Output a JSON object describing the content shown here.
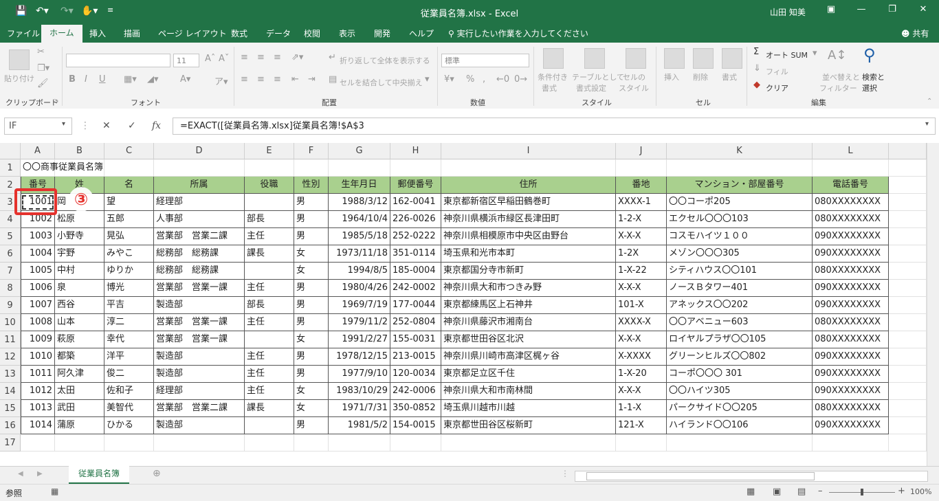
{
  "titlebar": {
    "doc_title": "従業員名簿.xlsx  -  Excel",
    "user": "山田 知美",
    "bg": "#217346"
  },
  "tabs": [
    "ファイル",
    "ホーム",
    "挿入",
    "描画",
    "ページ レイアウト",
    "数式",
    "データ",
    "校閲",
    "表示",
    "開発",
    "ヘルプ"
  ],
  "tell_me": "実行したい作業を入力してください",
  "share": "共有",
  "ribbon": {
    "groups": [
      "クリップボード",
      "フォント",
      "配置",
      "数値",
      "スタイル",
      "セル",
      "編集"
    ],
    "paste": "貼り付け",
    "font_size": "11",
    "wrap_text": "折り返して全体を表示する",
    "merge_center": "セルを結合して中央揃え",
    "number_format": "標準",
    "cond_format": [
      "条件付き",
      "書式"
    ],
    "table_format": [
      "テーブルとして",
      "書式設定"
    ],
    "cell_styles": [
      "セルの",
      "スタイル"
    ],
    "insert": "挿入",
    "delete": "削除",
    "format": "書式",
    "autosum": "オート SUM",
    "fill": "フィル",
    "clear": "クリア",
    "sort_filter": [
      "並べ替えと",
      "フィルター"
    ],
    "find_select": [
      "検索と",
      "選択"
    ]
  },
  "formula_bar": {
    "name_box": "IF",
    "formula": "=EXACT([従業員名簿.xlsx]従業員名簿!$A$3"
  },
  "columns": [
    "A",
    "B",
    "C",
    "D",
    "E",
    "F",
    "G",
    "H",
    "I",
    "J",
    "K",
    "L"
  ],
  "title_cell": "〇〇商事従業員名簿",
  "headers": [
    "番号",
    "姓",
    "名",
    "所属",
    "役職",
    "性別",
    "生年月日",
    "郵便番号",
    "住所",
    "番地",
    "マンション・部屋番号",
    "電話番号"
  ],
  "rows": [
    [
      "1001",
      "岡",
      "望",
      "経理部",
      "",
      "男",
      "1988/3/12",
      "162-0041",
      "東京都新宿区早稲田鶴巻町",
      "XXXX-1",
      "〇〇コーポ205",
      "080XXXXXXXX"
    ],
    [
      "1002",
      "松原",
      "五郎",
      "人事部",
      "部長",
      "男",
      "1964/10/4",
      "226-0026",
      "神奈川県横浜市緑区長津田町",
      "1-2-X",
      "エクセル〇〇〇103",
      "080XXXXXXXX"
    ],
    [
      "1003",
      "小野寺",
      "晃弘",
      "営業部　営業二課",
      "主任",
      "男",
      "1985/5/18",
      "252-0222",
      "神奈川県相模原市中央区由野台",
      "X-X-X",
      "コスモハイツ１００",
      "090XXXXXXXX"
    ],
    [
      "1004",
      "宇野",
      "みやこ",
      "総務部　総務課",
      "課長",
      "女",
      "1973/11/18",
      "351-0114",
      "埼玉県和光市本町",
      "1-2X",
      "メゾン〇〇〇305",
      "090XXXXXXXX"
    ],
    [
      "1005",
      "中村",
      "ゆりか",
      "総務部　総務課",
      "",
      "女",
      "1994/8/5",
      "185-0004",
      "東京都国分寺市新町",
      "1-X-22",
      "シティハウス〇〇101",
      "080XXXXXXXX"
    ],
    [
      "1006",
      "泉",
      "博光",
      "営業部　営業一課",
      "主任",
      "男",
      "1980/4/26",
      "242-0002",
      "神奈川県大和市つきみ野",
      "X-X-X",
      "ノースＢタワー401",
      "090XXXXXXXX"
    ],
    [
      "1007",
      "西谷",
      "平吉",
      "製造部",
      "部長",
      "男",
      "1969/7/19",
      "177-0044",
      "東京都練馬区上石神井",
      "101-X",
      "アネックス〇〇202",
      "090XXXXXXXX"
    ],
    [
      "1008",
      "山本",
      "淳二",
      "営業部　営業一課",
      "主任",
      "男",
      "1979/11/2",
      "252-0804",
      "神奈川県藤沢市湘南台",
      "XXXX-X",
      "〇〇アベニュー603",
      "080XXXXXXXX"
    ],
    [
      "1009",
      "萩原",
      "幸代",
      "営業部　営業一課",
      "",
      "女",
      "1991/2/27",
      "155-0031",
      "東京都世田谷区北沢",
      "X-X-X",
      "ロイヤルプラザ〇〇105",
      "080XXXXXXXX"
    ],
    [
      "1010",
      "都築",
      "洋平",
      "製造部",
      "主任",
      "男",
      "1978/12/15",
      "213-0015",
      "神奈川県川崎市高津区梶ヶ谷",
      "X-XXXX",
      "グリーンヒルズ〇〇802",
      "090XXXXXXXX"
    ],
    [
      "1011",
      "阿久津",
      "俊二",
      "製造部",
      "主任",
      "男",
      "1977/9/10",
      "120-0034",
      "東京都足立区千住",
      "1-X-20",
      "コーポ〇〇〇 301",
      "090XXXXXXXX"
    ],
    [
      "1012",
      "太田",
      "佐和子",
      "経理部",
      "主任",
      "女",
      "1983/10/29",
      "242-0006",
      "神奈川県大和市南林間",
      "X-X-X",
      "〇〇ハイツ305",
      "090XXXXXXXX"
    ],
    [
      "1013",
      "武田",
      "美智代",
      "営業部　営業二課",
      "課長",
      "女",
      "1971/7/31",
      "350-0852",
      "埼玉県川越市川越",
      "1-1-X",
      "パークサイド〇〇205",
      "080XXXXXXXX"
    ],
    [
      "1014",
      "蒲原",
      "ひかる",
      "製造部",
      "",
      "男",
      "1981/5/2",
      "154-0015",
      "東京都世田谷区桜新町",
      "121-X",
      "ハイランド〇〇106",
      "090XXXXXXXX"
    ]
  ],
  "row_numbers": [
    "1",
    "2",
    "3",
    "4",
    "5",
    "6",
    "7",
    "8",
    "9",
    "10",
    "11",
    "12",
    "13",
    "14",
    "15",
    "16",
    "17"
  ],
  "callout": "③",
  "sheet_tab": "従業員名簿",
  "status": {
    "mode": "参照",
    "zoom": "100%"
  },
  "colors": {
    "header_fill": "#a9d08e",
    "accent": "#217346",
    "callout": "#e5322d"
  }
}
